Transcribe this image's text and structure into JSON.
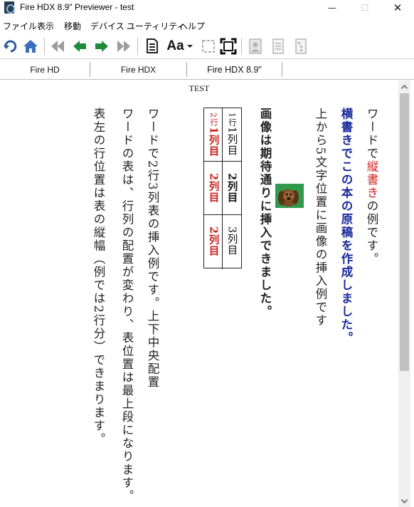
{
  "window": {
    "title": "Fire HDX 8.9\" Previewer - test",
    "min_glyph": "—",
    "max_glyph": "☐",
    "close_glyph": "✕"
  },
  "menu": {
    "items": [
      "ファイル",
      "表示",
      "移動",
      "デバイス",
      "ユーティリティ",
      "ヘルプ"
    ]
  },
  "toolbar": {
    "font_label": "Aa",
    "icons": [
      "refresh-icon",
      "home-icon",
      "first-page-icon",
      "back-arrow-icon",
      "forward-arrow-icon",
      "last-page-icon",
      "document-icon",
      "font-icon",
      "fit-page-icon",
      "full-screen-icon",
      "person-icon",
      "page-icon",
      "toc-icon"
    ]
  },
  "tabs": [
    {
      "label": "Fire HD"
    },
    {
      "label": "Fire HDX"
    },
    {
      "label": "Fire HDX 8.9\""
    }
  ],
  "document": {
    "title": "TEST",
    "col1": {
      "a": "ワードで",
      "b": "縦書き",
      "c": "の例です。"
    },
    "col2": "横書きでこの本の原稿を作成しました。",
    "col3": "上から5文字位置に画像の挿入例です",
    "col4": "画像は期待通りに挿入できました。",
    "table": {
      "c1r0_a": "1",
      "c1r0_b": "行",
      "c1r0_c": "1列目",
      "c1r1": "2列目",
      "c1r2": "3列目",
      "c2r0_a": "2",
      "c2r0_b": "行",
      "c2r0_c": "1列目",
      "c2r1": "2列目",
      "c2r2": "2列目"
    },
    "col5": "ワードで2行3列表の挿入例です。上下中央配置",
    "col6": "ワードの表は、行列の配置が変わり、表位置は最上段になります。",
    "col7": "表左の行位置は表の縦幅（例では2行分）できまります。"
  },
  "colors": {
    "accent_red": "#d0201c",
    "accent_blue": "#1a2a9a",
    "nav_green": "#1f8a3a"
  }
}
